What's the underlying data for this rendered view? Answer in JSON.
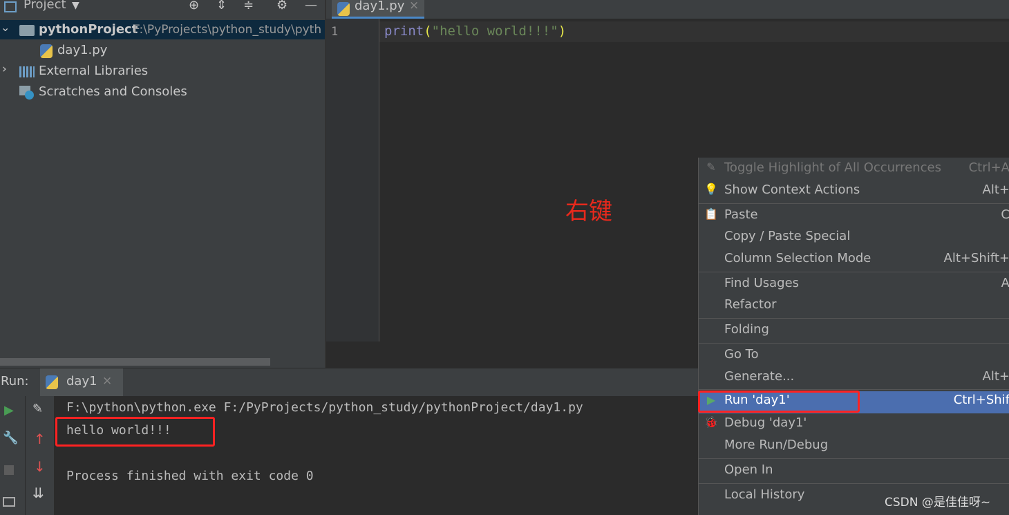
{
  "project": {
    "title": "Project",
    "tree": [
      {
        "name": "pythonProject",
        "path": "F:\\PyProjects\\python_study\\pyth"
      },
      {
        "name": "day1.py"
      },
      {
        "name": "External Libraries"
      },
      {
        "name": "Scratches and Consoles"
      }
    ]
  },
  "editor": {
    "tab": "day1.py",
    "tab_close": "×",
    "line_number": "1",
    "code": {
      "func": "print",
      "open": "(",
      "string": "\"hello world!!!\"",
      "close": ")"
    }
  },
  "annotation": {
    "label": "右键"
  },
  "run": {
    "label": "Run:",
    "tab": "day1",
    "tab_close": "×",
    "console": [
      "F:\\python\\python.exe F:/PyProjects/python_study/pythonProject/day1.py",
      "hello world!!!",
      "",
      "Process finished with exit code 0"
    ]
  },
  "context_menu": {
    "items": [
      {
        "label": "Toggle Highlight of All Occurrences",
        "shortcut": "Ctrl+A",
        "icon": "pencil-icon",
        "disabled": true
      },
      {
        "label": "Show Context Actions",
        "shortcut": "Alt+",
        "icon": "lightbulb-icon"
      },
      {
        "label": "Paste",
        "shortcut": "C",
        "icon": "clipboard-icon"
      },
      {
        "label": "Copy / Paste Special",
        "shortcut": ""
      },
      {
        "label": "Column Selection Mode",
        "shortcut": "Alt+Shift+"
      },
      {
        "label": "Find Usages",
        "shortcut": "A"
      },
      {
        "label": "Refactor",
        "shortcut": ""
      },
      {
        "label": "Folding",
        "shortcut": ""
      },
      {
        "label": "Go To",
        "shortcut": ""
      },
      {
        "label": "Generate...",
        "shortcut": "Alt+"
      },
      {
        "label": "Run 'day1'",
        "shortcut": "Ctrl+Shif",
        "icon": "play-icon",
        "selected": true
      },
      {
        "label": "Debug 'day1'",
        "shortcut": "",
        "icon": "bug-icon"
      },
      {
        "label": "More Run/Debug",
        "shortcut": ""
      },
      {
        "label": "Open In",
        "shortcut": ""
      },
      {
        "label": "Local History",
        "shortcut": ""
      }
    ]
  },
  "watermark": "CSDN @是佳佳呀~",
  "colors": {
    "selection": "#4b6eaf",
    "annotation": "#e8291c",
    "string": "#6a8759",
    "keyword": "#8888c6"
  }
}
